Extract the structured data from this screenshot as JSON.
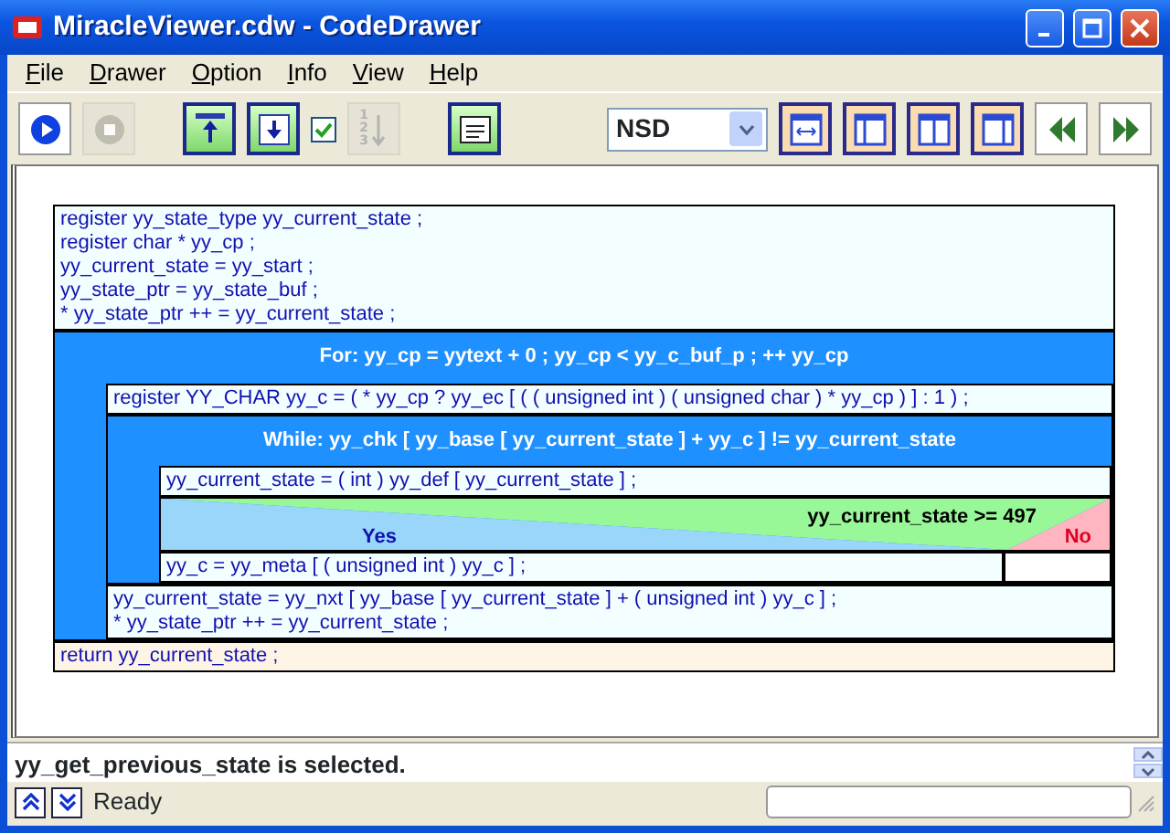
{
  "window": {
    "title": "MiracleViewer.cdw - CodeDrawer"
  },
  "menu": [
    {
      "label": "File"
    },
    {
      "label": "Drawer"
    },
    {
      "label": "Option"
    },
    {
      "label": "Info"
    },
    {
      "label": "View"
    },
    {
      "label": "Help"
    }
  ],
  "toolbar": [
    {
      "kind": "run",
      "disabled": false
    },
    {
      "kind": "stop",
      "disabled": true
    },
    {
      "kind": "gap"
    },
    {
      "kind": "top",
      "disabled": false
    },
    {
      "kind": "bottom",
      "disabled": false
    },
    {
      "kind": "checkbox",
      "checked": true
    },
    {
      "kind": "numbering",
      "disabled": true,
      "digits": [
        "1",
        "2",
        "3"
      ]
    },
    {
      "kind": "gap"
    },
    {
      "kind": "outline",
      "disabled": false
    },
    {
      "kind": "spacer"
    },
    {
      "kind": "combo",
      "value": "NSD"
    },
    {
      "kind": "fit-width",
      "disabled": false
    },
    {
      "kind": "left-pane",
      "disabled": false
    },
    {
      "kind": "split-pane",
      "disabled": false
    },
    {
      "kind": "right-pane",
      "disabled": false
    },
    {
      "kind": "back",
      "disabled": false
    },
    {
      "kind": "forward",
      "disabled": false
    }
  ],
  "diagram": [
    {
      "kind": "block",
      "lines": [
        "register yy_state_type yy_current_state ;",
        "register char * yy_cp ;",
        "yy_current_state = yy_start ;",
        "yy_state_ptr = yy_state_buf ;",
        "* yy_state_ptr ++ = yy_current_state ;"
      ]
    },
    {
      "kind": "loop",
      "header": "For: yy_cp = yytext + 0 ; yy_cp < yy_c_buf_p ; ++ yy_cp",
      "children": [
        {
          "kind": "block",
          "lines": [
            "register YY_CHAR yy_c = ( * yy_cp ? yy_ec [ ( ( unsigned int ) ( unsigned char ) * yy_cp ) ] : 1 ) ;"
          ]
        },
        {
          "kind": "loop",
          "header": "While: yy_chk [ yy_base [ yy_current_state ] + yy_c ] != yy_current_state",
          "children": [
            {
              "kind": "block",
              "lines": [
                "yy_current_state = ( int ) yy_def [ yy_current_state ] ;"
              ]
            },
            {
              "kind": "if",
              "condition": "yy_current_state >= 497",
              "yes_label": "Yes",
              "no_label": "No",
              "yes": [
                {
                  "kind": "block",
                  "lines": [
                    "yy_c = yy_meta [ ( unsigned int ) yy_c ] ;"
                  ]
                }
              ]
            }
          ]
        },
        {
          "kind": "block",
          "lines": [
            "yy_current_state = yy_nxt [ yy_base [ yy_current_state ] + ( unsigned int ) yy_c ] ;",
            "* yy_state_ptr ++ = yy_current_state ;"
          ]
        }
      ]
    },
    {
      "kind": "return",
      "lines": [
        "return yy_current_state ;"
      ]
    }
  ],
  "message": "yy_get_previous_state is selected.",
  "status_bar": {
    "text": "Ready"
  }
}
